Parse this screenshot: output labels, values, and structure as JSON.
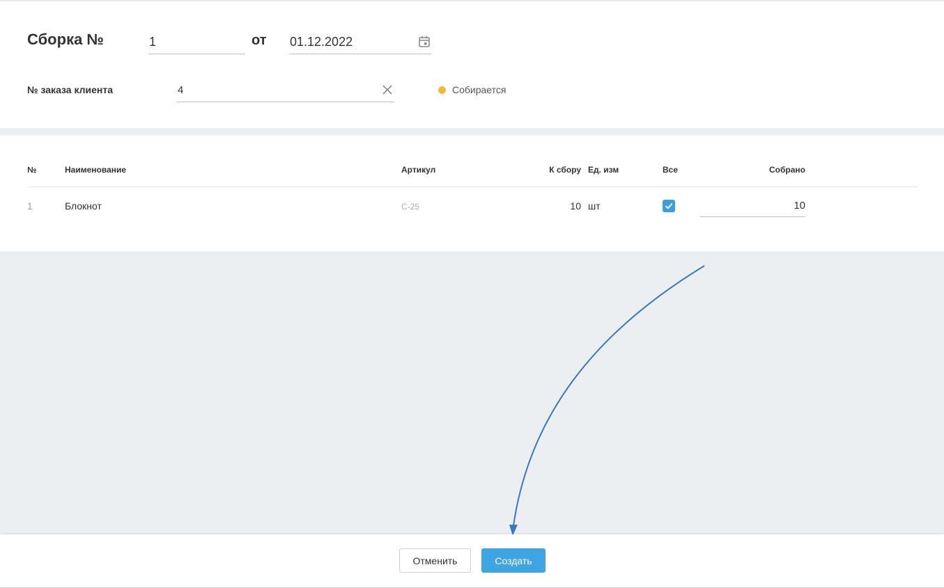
{
  "header": {
    "title": "Сборка №",
    "number": "1",
    "from_label": "от",
    "date": "01.12.2022",
    "order_label": "№ заказа клиента",
    "order_value": "4",
    "status_text": "Собирается",
    "status_color": "#f5b93a"
  },
  "table": {
    "columns": {
      "num": "№",
      "name": "Наименование",
      "sku": "Артикул",
      "to_collect": "К сбору",
      "unit": "Ед. изм",
      "all": "Все",
      "collected": "Собрано"
    },
    "rows": [
      {
        "num": "1",
        "name": "Блокнот",
        "sku": "С-25",
        "to_collect": "10",
        "unit": "шт",
        "all_checked": true,
        "collected": "10"
      }
    ]
  },
  "footer": {
    "cancel_label": "Отменить",
    "create_label": "Создать"
  },
  "colors": {
    "accent": "#3fa4e2",
    "annotation_arrow": "#3a78c0"
  },
  "icons": {
    "date_picker": "calendar-icon",
    "clear_order": "close-icon",
    "checkbox": "check-icon"
  }
}
